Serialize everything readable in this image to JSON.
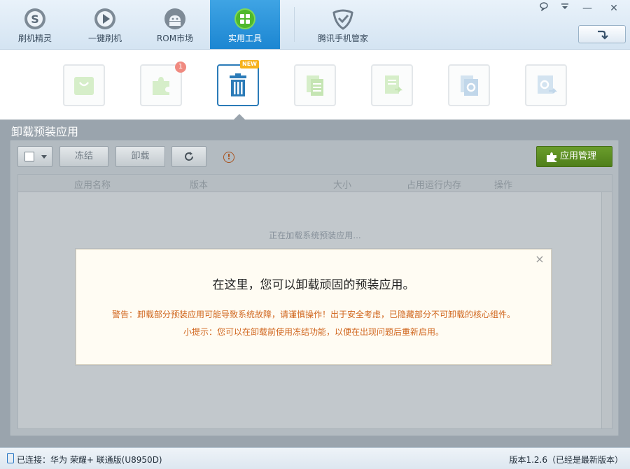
{
  "nav": {
    "tabs": [
      {
        "label": "刷机精灵",
        "icon": "shuaji-logo-icon"
      },
      {
        "label": "一键刷机",
        "icon": "play-circle-icon"
      },
      {
        "label": "ROM市场",
        "icon": "android-icon"
      },
      {
        "label": "实用工具",
        "icon": "apps-grid-icon",
        "active": true
      },
      {
        "label": "腾讯手机管家",
        "icon": "shield-check-icon"
      }
    ]
  },
  "window": {
    "feedback_icon": "chat-bubble-icon",
    "menu_icon": "dropdown-menu-icon",
    "minimize_label": "—",
    "close_label": "✕",
    "refresh_icon": "arrow-turn-down-icon"
  },
  "tools": [
    {
      "icon": "bag-icon"
    },
    {
      "icon": "puzzle-icon",
      "badge": "1"
    },
    {
      "icon": "trash-icon",
      "badge": "NEW",
      "active": true
    },
    {
      "icon": "documents-icon"
    },
    {
      "icon": "doc-export-icon"
    },
    {
      "icon": "settings-doc-icon"
    },
    {
      "icon": "settings-export-icon"
    }
  ],
  "section": {
    "title": "卸载预装应用"
  },
  "toolbar": {
    "freeze_label": "冻结",
    "uninstall_label": "卸载",
    "reload_icon": "refresh-icon",
    "warning_icon": "warning-circle-icon",
    "app_manage_label": "应用管理"
  },
  "table": {
    "columns": [
      "应用名称",
      "版本",
      "大小",
      "占用运行内存",
      "操作"
    ],
    "loading_text": "正在加载系统预装应用..."
  },
  "dialog": {
    "title": "在这里，您可以卸载顽固的预装应用。",
    "warning": "警告：卸载部分预装应用可能导致系统故障，请谨慎操作！出于安全考虑，已隐藏部分不可卸载的核心组件。",
    "tip": "小提示：您可以在卸载前使用冻结功能，以便在出现问题后重新启用。",
    "close_label": "×"
  },
  "status": {
    "connection": "已连接：华为 荣耀+ 联通版(U8950D)",
    "version": "版本1.2.6（已经是最新版本）"
  },
  "colors": {
    "nav_active": "#1c86d2",
    "app_manage": "#5a8c22",
    "warning_text": "#d0651c",
    "panel_overlay": "#9aa4ad"
  }
}
